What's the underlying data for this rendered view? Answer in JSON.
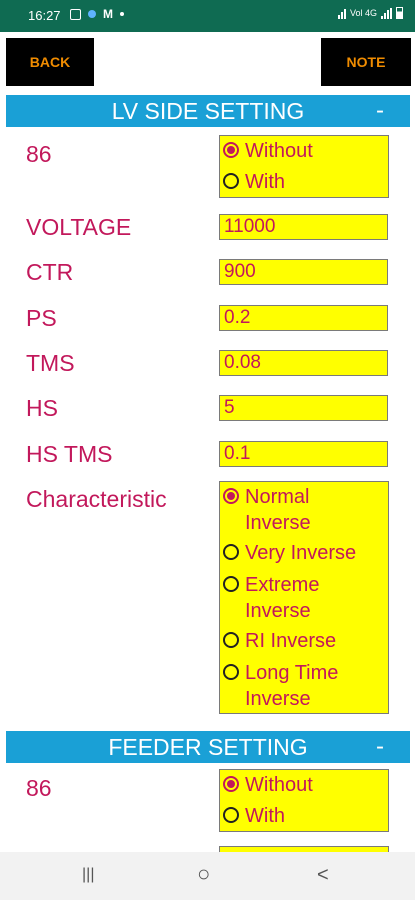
{
  "status_bar": {
    "time": "16:27",
    "net_label": "Vol 4G",
    "icons": [
      "gallery-icon",
      "bluetooth-dot-icon",
      "m-app-icon",
      "dot-icon",
      "wifi-icon",
      "signal-icon",
      "battery-icon"
    ]
  },
  "toolbar": {
    "back_label": "BACK",
    "note_label": "NOTE"
  },
  "lv_section": {
    "title": "LV SIDE SETTING",
    "collapse_symbol": "-",
    "relay86": {
      "label": "86",
      "options": [
        "Without",
        "With"
      ],
      "selected": "Without"
    },
    "fields": [
      {
        "label": "VOLTAGE",
        "value": "11000"
      },
      {
        "label": "CTR",
        "value": "900"
      },
      {
        "label": "PS",
        "value": "0.2"
      },
      {
        "label": "TMS",
        "value": "0.08"
      },
      {
        "label": "HS",
        "value": "5"
      },
      {
        "label": "HS TMS",
        "value": "0.1"
      }
    ],
    "characteristic": {
      "label": "Characteristic",
      "options": [
        {
          "line1": "Normal",
          "line2": "Inverse"
        },
        {
          "line1": "Very  Inverse",
          "line2": ""
        },
        {
          "line1": "Extreme",
          "line2": "Inverse"
        },
        {
          "line1": "RI  Inverse",
          "line2": ""
        },
        {
          "line1": "Long Time",
          "line2": "Inverse"
        }
      ],
      "selected": "Normal Inverse"
    }
  },
  "feeder_section": {
    "title": "FEEDER SETTING",
    "collapse_symbol": "-",
    "relay86": {
      "label": "86",
      "options": [
        "Without",
        "With"
      ],
      "selected": "Without"
    }
  },
  "nav_bar": {
    "recents_symbol": "|||",
    "home_symbol": "○",
    "back_symbol": "<"
  },
  "colors": {
    "status_bar": "#0f6b52",
    "header": "#1aa0d6",
    "label_text": "#c2185b",
    "field_bg": "#ffff00",
    "button_bg": "#000000",
    "button_text": "#f08c00"
  }
}
